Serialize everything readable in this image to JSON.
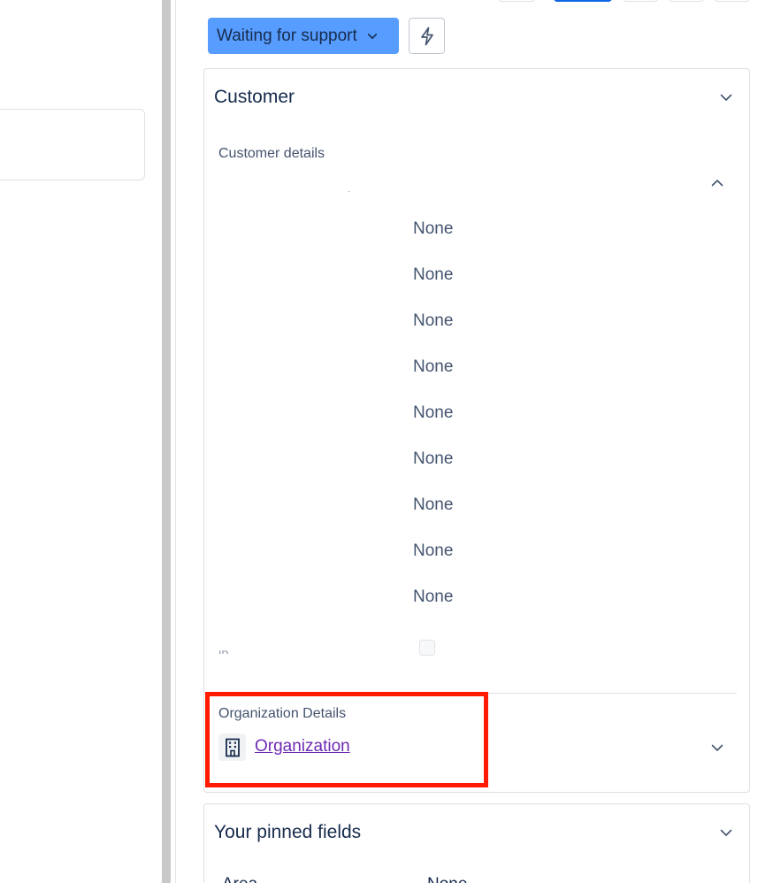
{
  "toolbar": {
    "status_label": "Waiting for support",
    "status_icon": "chevron-down-icon",
    "action_icon": "lightning-icon"
  },
  "customer_card": {
    "title": "Customer",
    "details_label": "Customer details",
    "values": [
      "None",
      "None",
      "None",
      "None",
      "None",
      "None",
      "None",
      "None",
      "None"
    ],
    "partial_label": "IP",
    "organization": {
      "label": "Organization Details",
      "link_text": "Organization",
      "icon": "building-icon"
    }
  },
  "pinned_card": {
    "title": "Your pinned fields",
    "row_label": "Area",
    "row_value": "None"
  },
  "colors": {
    "status_button": "#579dff",
    "highlight": "#ff1a00",
    "link": "#6e2bb3",
    "active_tab": "#0c66e4"
  }
}
